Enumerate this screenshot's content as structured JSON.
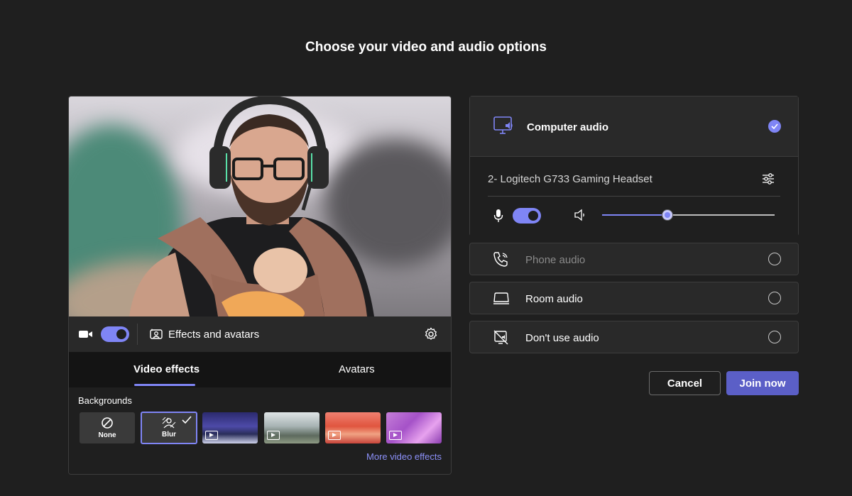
{
  "page": {
    "title": "Choose your video and audio options"
  },
  "video": {
    "camera_on": true,
    "effects_label": "Effects and avatars",
    "tabs": [
      {
        "label": "Video effects",
        "active": true
      },
      {
        "label": "Avatars",
        "active": false
      }
    ],
    "backgrounds_label": "Backgrounds",
    "backgrounds": [
      {
        "label": "None",
        "icon": "none-icon",
        "selected": false
      },
      {
        "label": "Blur",
        "icon": "blur-icon",
        "selected": true
      },
      {
        "label": "",
        "icon": "video-background-icon",
        "selected": false
      },
      {
        "label": "",
        "icon": "video-background-icon",
        "selected": false
      },
      {
        "label": "",
        "icon": "video-background-icon",
        "selected": false
      },
      {
        "label": "",
        "icon": "video-background-icon",
        "selected": false
      }
    ],
    "more_effects_label": "More video effects"
  },
  "audio": {
    "options": [
      {
        "label": "Computer audio",
        "selected": true,
        "icon": "computer-audio-icon"
      },
      {
        "label": "Phone audio",
        "selected": false,
        "disabled": true,
        "icon": "phone-audio-icon"
      },
      {
        "label": "Room audio",
        "selected": false,
        "icon": "room-audio-icon"
      },
      {
        "label": "Don't use audio",
        "selected": false,
        "icon": "no-audio-icon"
      }
    ],
    "device_name": "2- Logitech G733 Gaming Headset",
    "mic_on": true,
    "speaker_volume": 0.38
  },
  "buttons": {
    "cancel": "Cancel",
    "join": "Join now"
  },
  "colors": {
    "accent": "#7f85f5",
    "primary_button": "#5b5fc7",
    "background": "#1f1f1f"
  }
}
